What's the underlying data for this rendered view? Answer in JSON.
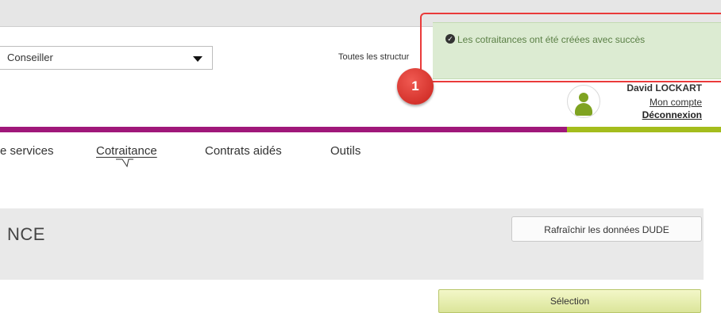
{
  "header": {
    "role_select": {
      "value": "Conseiller"
    },
    "structures_label": "Toutes les structur",
    "user": {
      "name": "David LOCKART",
      "account_link": "Mon compte",
      "logout_link": "Déconnexion"
    }
  },
  "nav": {
    "items": [
      {
        "label": "e services"
      },
      {
        "label": "Cotraitance"
      },
      {
        "label": "Contrats aidés"
      },
      {
        "label": "Outils"
      }
    ],
    "active": "Cotraitance"
  },
  "page": {
    "title": "NCE",
    "refresh_button": "Rafraîchir les données DUDE",
    "selection_button": "Sélection"
  },
  "toast": {
    "message": "Les cotraitances ont été créées avec succès",
    "icon": "check-circle-icon"
  },
  "callout": {
    "number": "1"
  },
  "colors": {
    "magenta_bar": "#a0187a",
    "green_bar": "#a4bd1d",
    "toast_bg": "#dcebd2",
    "callout_red": "#e0302a"
  }
}
